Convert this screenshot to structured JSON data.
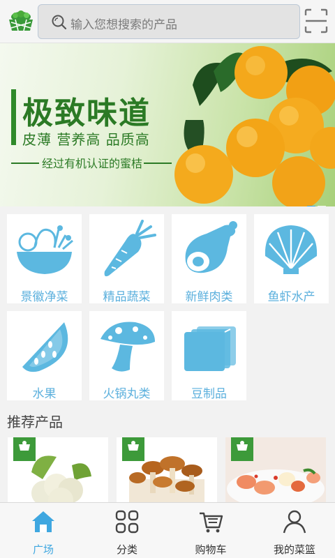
{
  "search": {
    "placeholder": "输入您想搜索的产品"
  },
  "banner": {
    "title": "极致味道",
    "subtitle": "皮薄  营养高  品质高",
    "tagline": "经过有机认证的蜜桔"
  },
  "categories": [
    {
      "label": "景徽净菜",
      "icon": "salad-bowl-icon"
    },
    {
      "label": "精品蔬菜",
      "icon": "carrot-icon"
    },
    {
      "label": "新鲜肉类",
      "icon": "ham-icon"
    },
    {
      "label": "鱼虾水产",
      "icon": "shell-icon"
    },
    {
      "label": "水果",
      "icon": "watermelon-icon"
    },
    {
      "label": "火锅丸类",
      "icon": "mushroom-icon"
    },
    {
      "label": "豆制品",
      "icon": "tofu-icon"
    }
  ],
  "recommend": {
    "title": "推荐产品",
    "products": [
      {
        "name": "cauliflower"
      },
      {
        "name": "mushrooms"
      },
      {
        "name": "shrimp"
      }
    ]
  },
  "tabbar": [
    {
      "label": "广场",
      "icon": "home-icon",
      "active": true
    },
    {
      "label": "分类",
      "icon": "grid-icon",
      "active": false
    },
    {
      "label": "购物车",
      "icon": "cart-icon",
      "active": false
    },
    {
      "label": "我的菜篮",
      "icon": "user-icon",
      "active": false
    }
  ],
  "colors": {
    "accent": "#5cb0dd",
    "active_tab": "#3fa7e0",
    "brand_green": "#2b7a25"
  }
}
